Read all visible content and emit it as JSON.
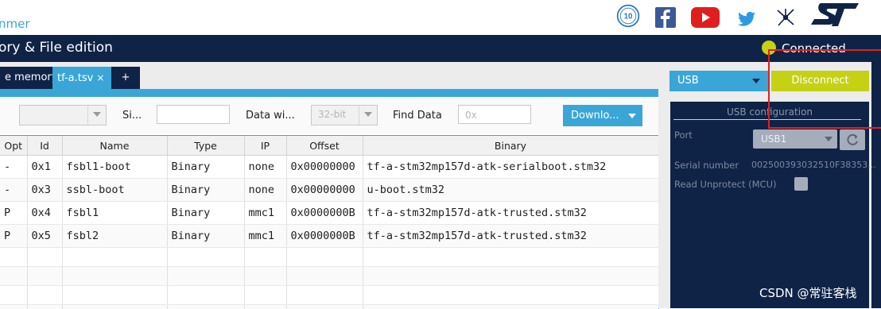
{
  "app": {
    "name_partial": "nmer",
    "window_title": "ory & File edition"
  },
  "status": {
    "label": "Connected",
    "color": "#c5d113"
  },
  "social_icons": [
    "anniversary-badge-icon",
    "facebook-icon",
    "youtube-icon",
    "twitter-icon",
    "network-share-icon",
    "st-logo-icon"
  ],
  "tabs": [
    {
      "label": "e memory"
    },
    {
      "label": "tf-a.tsv",
      "close": "×"
    },
    {
      "label": "+"
    }
  ],
  "toolbar": {
    "size_label": "Si...",
    "data_width_label": "Data wi...",
    "data_width_value": "32-bit",
    "find_label": "Find Data",
    "find_placeholder": "0x",
    "download_label": "Downlo..."
  },
  "table": {
    "headers": [
      "Opt",
      "Id",
      "Name",
      "Type",
      "IP",
      "Offset",
      "Binary"
    ],
    "rows": [
      [
        "-",
        "0x1",
        "fsbl1-boot",
        "Binary",
        "none",
        "0x00000000",
        "tf-a-stm32mp157d-atk-serialboot.stm32"
      ],
      [
        "-",
        "0x3",
        "ssbl-boot",
        "Binary",
        "none",
        "0x00000000",
        "u-boot.stm32"
      ],
      [
        "P",
        "0x4",
        "fsbl1",
        "Binary",
        "mmc1",
        "0x0000000B",
        "tf-a-stm32mp157d-atk-trusted.stm32"
      ],
      [
        "P",
        "0x5",
        "fsbl2",
        "Binary",
        "mmc1",
        "0x0000000B",
        "tf-a-stm32mp157d-atk-trusted.stm32"
      ]
    ]
  },
  "connection": {
    "interface": "USB",
    "disconnect_label": "Disconnect",
    "config_title": "USB configuration",
    "port_label": "Port",
    "port_value": "USB1",
    "serial_label": "Serial number",
    "serial_value": "002500393032510F38353...",
    "read_unprotect_label": "Read Unprotect (MCU)"
  },
  "watermark": "CSDN @常驻客栈",
  "colors": {
    "accent": "#3aa6d8",
    "navy": "#0f2346",
    "connect_green": "#c5d113",
    "annotation_red": "#e02020"
  }
}
